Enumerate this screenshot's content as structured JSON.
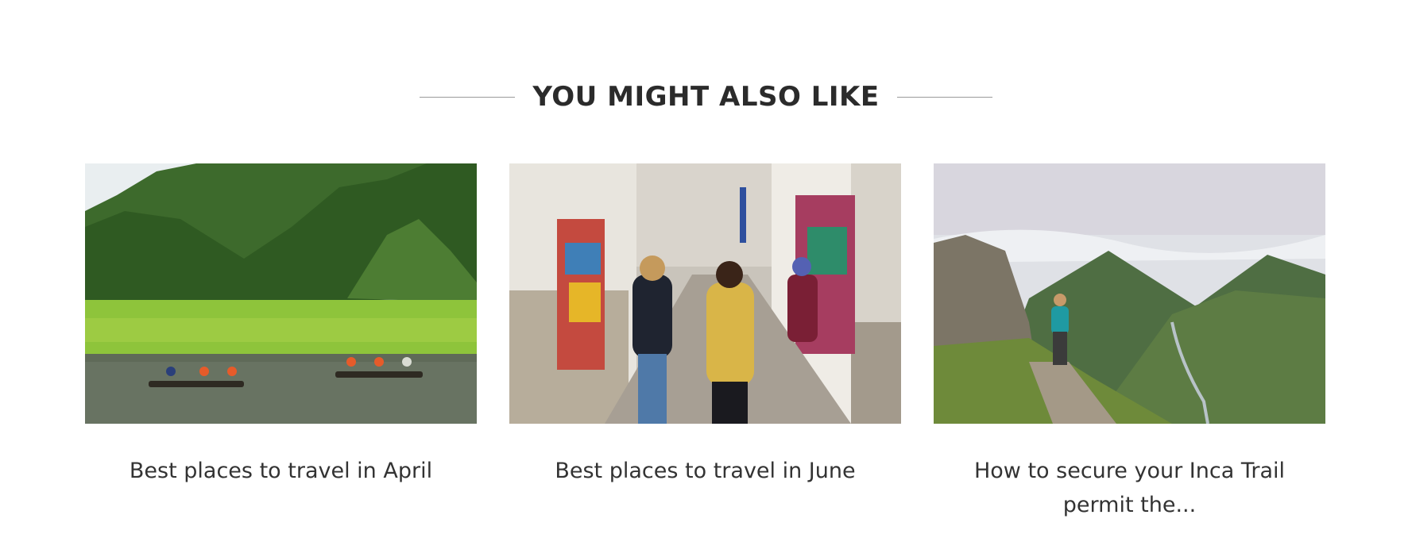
{
  "section": {
    "title": "YOU MIGHT ALSO LIKE"
  },
  "cards": [
    {
      "title": "Best places to travel in April",
      "image": "boats-on-river-with-mountains-photo"
    },
    {
      "title": "Best places to travel in June",
      "image": "market-street-with-travelers-photo"
    },
    {
      "title": "How to secure your Inca Trail permit the...",
      "image": "hiker-on-mountain-trail-photo"
    }
  ],
  "colors": {
    "text": "#333333",
    "rule": "#9a9a9a",
    "background": "#ffffff"
  }
}
